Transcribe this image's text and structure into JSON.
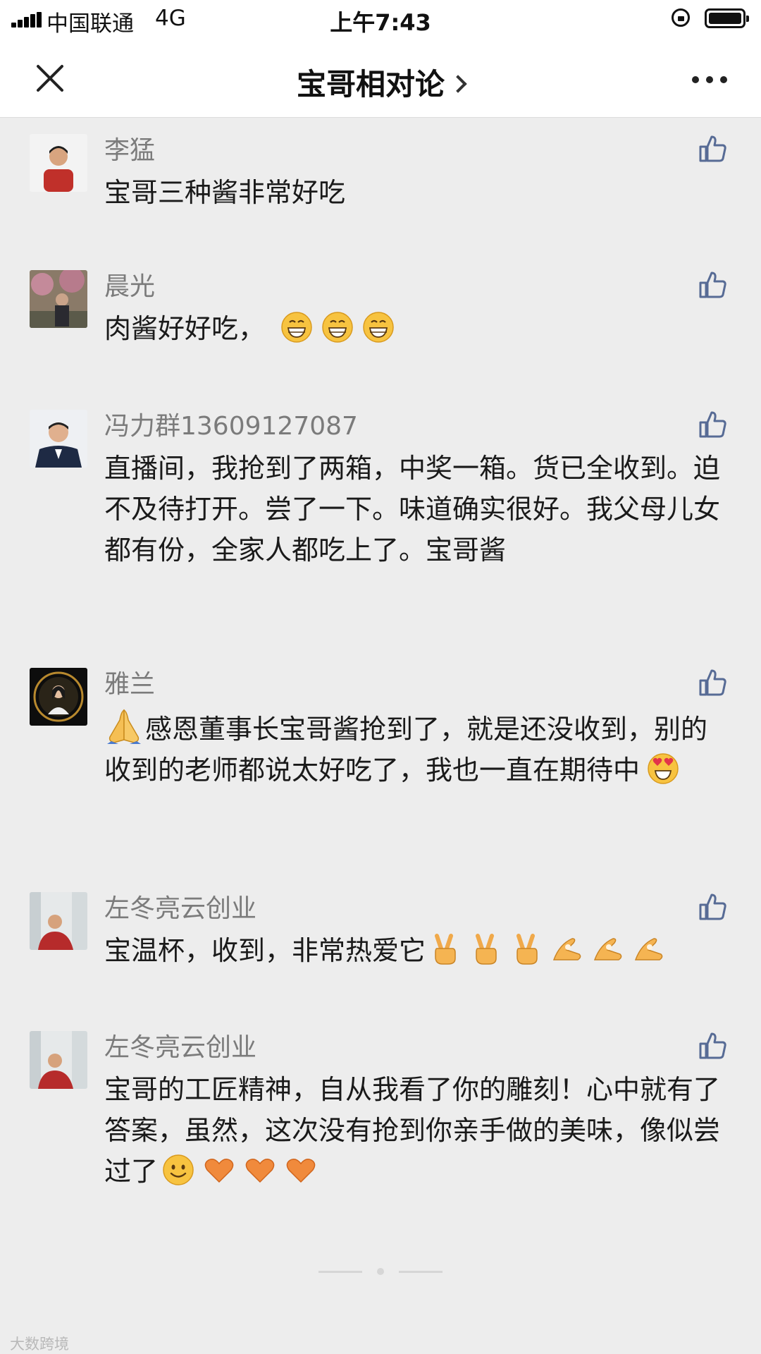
{
  "status_bar": {
    "carrier": "中国联通",
    "network": "4G",
    "time": "上午7:43"
  },
  "nav": {
    "title": "宝哥相对论"
  },
  "comments": [
    {
      "name": "李猛",
      "text": "宝哥三种酱非常好吃",
      "emojis": []
    },
    {
      "name": "晨光",
      "text": "肉酱好好吃，",
      "emojis": [
        "grin-emoji",
        "grin-emoji",
        "grin-emoji"
      ]
    },
    {
      "name": "冯力群13609127087",
      "text": "直播间，我抢到了两箱，中奖一箱。货已全收到。迫不及待打开。尝了一下。味道确实很好。我父母儿女都有份，全家人都吃上了。宝哥酱",
      "emojis": []
    },
    {
      "name": "雅兰",
      "text": "感恩董事长宝哥酱抢到了，就是还没收到，别的收到的老师都说太好吃了，我也一直在期待中",
      "lead_emoji": "pray-emoji",
      "emojis": [
        "heart-eyes-emoji"
      ]
    },
    {
      "name": "左冬亮云创业",
      "text": "宝温杯，收到，非常热爱它",
      "emojis": [
        "victory-hand-emoji",
        "victory-hand-emoji",
        "victory-hand-emoji",
        "ok-hand-emoji",
        "ok-hand-emoji",
        "ok-hand-emoji"
      ]
    },
    {
      "name": "左冬亮云创业",
      "text": "宝哥的工匠精神，自从我看了你的雕刻！心中就有了答案，虽然，这次没有抢到你亲手做的美味，像似尝过了",
      "emojis": [
        "smile-emoji",
        "heart-emoji",
        "heart-emoji",
        "heart-emoji"
      ]
    }
  ],
  "watermark": "大数跨境",
  "colors": {
    "background": "#ededed",
    "name": "#7b7b7b",
    "icon": "#576b95"
  }
}
